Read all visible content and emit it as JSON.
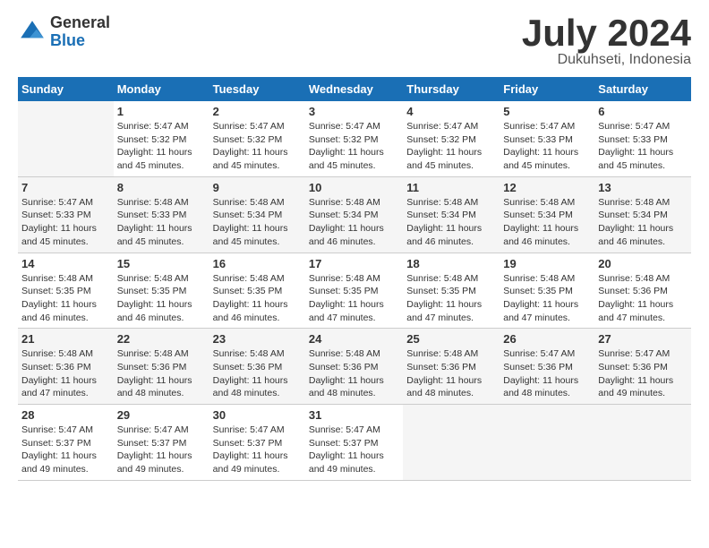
{
  "header": {
    "logo_general": "General",
    "logo_blue": "Blue",
    "month_title": "July 2024",
    "location": "Dukuhseti, Indonesia"
  },
  "calendar": {
    "days_of_week": [
      "Sunday",
      "Monday",
      "Tuesday",
      "Wednesday",
      "Thursday",
      "Friday",
      "Saturday"
    ],
    "weeks": [
      [
        {
          "day": "",
          "info": ""
        },
        {
          "day": "1",
          "info": "Sunrise: 5:47 AM\nSunset: 5:32 PM\nDaylight: 11 hours\nand 45 minutes."
        },
        {
          "day": "2",
          "info": "Sunrise: 5:47 AM\nSunset: 5:32 PM\nDaylight: 11 hours\nand 45 minutes."
        },
        {
          "day": "3",
          "info": "Sunrise: 5:47 AM\nSunset: 5:32 PM\nDaylight: 11 hours\nand 45 minutes."
        },
        {
          "day": "4",
          "info": "Sunrise: 5:47 AM\nSunset: 5:32 PM\nDaylight: 11 hours\nand 45 minutes."
        },
        {
          "day": "5",
          "info": "Sunrise: 5:47 AM\nSunset: 5:33 PM\nDaylight: 11 hours\nand 45 minutes."
        },
        {
          "day": "6",
          "info": "Sunrise: 5:47 AM\nSunset: 5:33 PM\nDaylight: 11 hours\nand 45 minutes."
        }
      ],
      [
        {
          "day": "7",
          "info": "Sunrise: 5:47 AM\nSunset: 5:33 PM\nDaylight: 11 hours\nand 45 minutes."
        },
        {
          "day": "8",
          "info": "Sunrise: 5:48 AM\nSunset: 5:33 PM\nDaylight: 11 hours\nand 45 minutes."
        },
        {
          "day": "9",
          "info": "Sunrise: 5:48 AM\nSunset: 5:34 PM\nDaylight: 11 hours\nand 45 minutes."
        },
        {
          "day": "10",
          "info": "Sunrise: 5:48 AM\nSunset: 5:34 PM\nDaylight: 11 hours\nand 46 minutes."
        },
        {
          "day": "11",
          "info": "Sunrise: 5:48 AM\nSunset: 5:34 PM\nDaylight: 11 hours\nand 46 minutes."
        },
        {
          "day": "12",
          "info": "Sunrise: 5:48 AM\nSunset: 5:34 PM\nDaylight: 11 hours\nand 46 minutes."
        },
        {
          "day": "13",
          "info": "Sunrise: 5:48 AM\nSunset: 5:34 PM\nDaylight: 11 hours\nand 46 minutes."
        }
      ],
      [
        {
          "day": "14",
          "info": "Sunrise: 5:48 AM\nSunset: 5:35 PM\nDaylight: 11 hours\nand 46 minutes."
        },
        {
          "day": "15",
          "info": "Sunrise: 5:48 AM\nSunset: 5:35 PM\nDaylight: 11 hours\nand 46 minutes."
        },
        {
          "day": "16",
          "info": "Sunrise: 5:48 AM\nSunset: 5:35 PM\nDaylight: 11 hours\nand 46 minutes."
        },
        {
          "day": "17",
          "info": "Sunrise: 5:48 AM\nSunset: 5:35 PM\nDaylight: 11 hours\nand 47 minutes."
        },
        {
          "day": "18",
          "info": "Sunrise: 5:48 AM\nSunset: 5:35 PM\nDaylight: 11 hours\nand 47 minutes."
        },
        {
          "day": "19",
          "info": "Sunrise: 5:48 AM\nSunset: 5:35 PM\nDaylight: 11 hours\nand 47 minutes."
        },
        {
          "day": "20",
          "info": "Sunrise: 5:48 AM\nSunset: 5:36 PM\nDaylight: 11 hours\nand 47 minutes."
        }
      ],
      [
        {
          "day": "21",
          "info": "Sunrise: 5:48 AM\nSunset: 5:36 PM\nDaylight: 11 hours\nand 47 minutes."
        },
        {
          "day": "22",
          "info": "Sunrise: 5:48 AM\nSunset: 5:36 PM\nDaylight: 11 hours\nand 48 minutes."
        },
        {
          "day": "23",
          "info": "Sunrise: 5:48 AM\nSunset: 5:36 PM\nDaylight: 11 hours\nand 48 minutes."
        },
        {
          "day": "24",
          "info": "Sunrise: 5:48 AM\nSunset: 5:36 PM\nDaylight: 11 hours\nand 48 minutes."
        },
        {
          "day": "25",
          "info": "Sunrise: 5:48 AM\nSunset: 5:36 PM\nDaylight: 11 hours\nand 48 minutes."
        },
        {
          "day": "26",
          "info": "Sunrise: 5:47 AM\nSunset: 5:36 PM\nDaylight: 11 hours\nand 48 minutes."
        },
        {
          "day": "27",
          "info": "Sunrise: 5:47 AM\nSunset: 5:36 PM\nDaylight: 11 hours\nand 49 minutes."
        }
      ],
      [
        {
          "day": "28",
          "info": "Sunrise: 5:47 AM\nSunset: 5:37 PM\nDaylight: 11 hours\nand 49 minutes."
        },
        {
          "day": "29",
          "info": "Sunrise: 5:47 AM\nSunset: 5:37 PM\nDaylight: 11 hours\nand 49 minutes."
        },
        {
          "day": "30",
          "info": "Sunrise: 5:47 AM\nSunset: 5:37 PM\nDaylight: 11 hours\nand 49 minutes."
        },
        {
          "day": "31",
          "info": "Sunrise: 5:47 AM\nSunset: 5:37 PM\nDaylight: 11 hours\nand 49 minutes."
        },
        {
          "day": "",
          "info": ""
        },
        {
          "day": "",
          "info": ""
        },
        {
          "day": "",
          "info": ""
        }
      ]
    ]
  }
}
